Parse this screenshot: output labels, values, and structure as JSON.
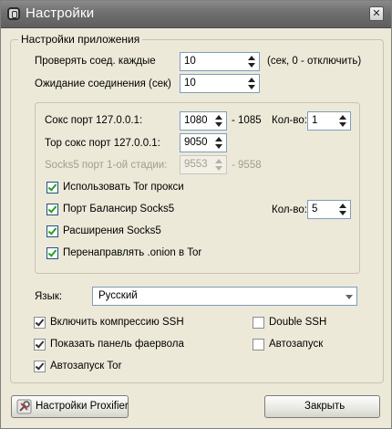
{
  "window": {
    "title": "Настройки"
  },
  "group": {
    "title": "Настройки приложения",
    "check_label": "Проверять соед. каждые",
    "check_value": "10",
    "check_hint": "(сек, 0 - отключить)",
    "timeout_label": "Ожидание соединения (сек)",
    "timeout_value": "10"
  },
  "ports": {
    "socks_label": "Сокс порт 127.0.0.1:",
    "socks_value": "1080",
    "socks_range_end": "- 1085",
    "count_label": "Кол-во:",
    "count_value": "1",
    "tor_label": "Тор сокс порт 127.0.0.1:",
    "tor_value": "9050",
    "stage1_label": "Socks5 порт 1-ой стадии:",
    "stage1_value": "9553",
    "stage1_range_end": "- 9558",
    "balancer_count_label": "Кол-во:",
    "balancer_count_value": "5"
  },
  "options": [
    {
      "label": "Использовать Tor прокси",
      "checked": true
    },
    {
      "label": "Порт Балансир Socks5",
      "checked": true
    },
    {
      "label": "Расширения Socks5",
      "checked": true
    },
    {
      "label": "Перенаправлять .onion в Tor",
      "checked": true
    }
  ],
  "language": {
    "label": "Язык:",
    "value": "Русский"
  },
  "extra": {
    "compress_ssh": {
      "label": "Включить компрессию SSH",
      "checked": true
    },
    "firewall_panel": {
      "label": "Показать панель фаервола",
      "checked": true
    },
    "autostart_tor": {
      "label": "Автозапуск Tor",
      "checked": true
    },
    "double_ssh": {
      "label": "Double SSH",
      "checked": false
    },
    "autostart": {
      "label": "Автозапуск",
      "checked": false
    }
  },
  "buttons": {
    "proxifier": "Настройки Proxifier",
    "close": "Закрыть"
  },
  "icons": {
    "app": "app-icon",
    "close": "close-icon",
    "proxifier": "wrench-icon"
  },
  "colors": {
    "titlebar": "#6f6f6f",
    "background": "#ece9d8",
    "checkmark": "#21a121"
  }
}
